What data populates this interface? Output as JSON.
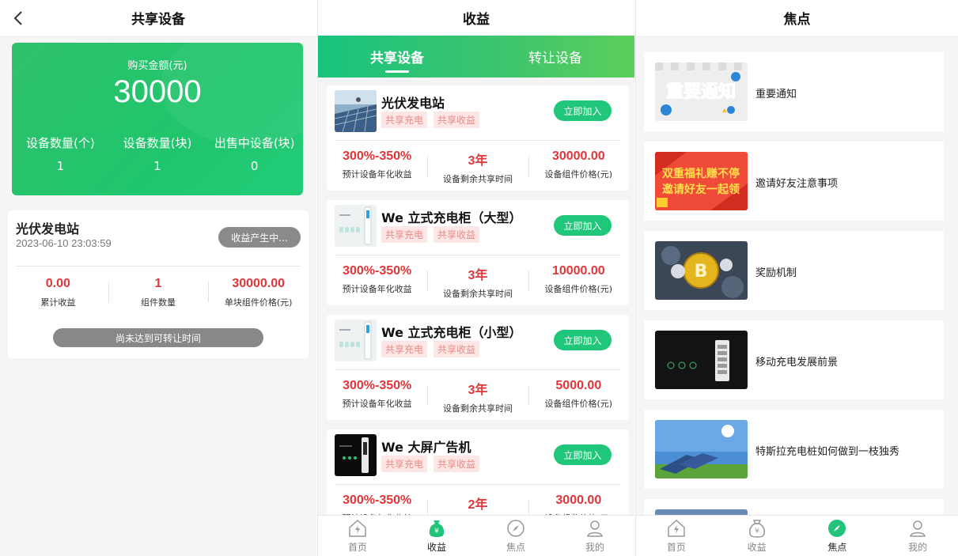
{
  "shared_devices_page": {
    "title": "共享设备",
    "summary": {
      "amount_label": "购买金额(元)",
      "amount": "30000",
      "stats": [
        {
          "label": "设备数量(个)",
          "value": "1"
        },
        {
          "label": "设备数量(块)",
          "value": "1"
        },
        {
          "label": "出售中设备(块)",
          "value": "0"
        }
      ]
    },
    "holding": {
      "name": "光伏发电站",
      "time": "2023-06-10 23:03:59",
      "status": "收益产生中...",
      "values": [
        {
          "value": "0.00",
          "label": "累计收益"
        },
        {
          "value": "1",
          "label": "组件数量"
        },
        {
          "value": "30000.00",
          "label": "单块组件价格(元)"
        }
      ],
      "transfer_button": "尚未达到可转让时间"
    }
  },
  "income_page": {
    "title": "收益",
    "tabs": [
      "共享设备",
      "转让设备"
    ],
    "active_tab": 0,
    "join_label": "立即加入",
    "tags": [
      "共享充电",
      "共享收益"
    ],
    "metric_labels": [
      "预计设备年化收益",
      "设备剩余共享时间",
      "设备组件价格(元)"
    ],
    "products": [
      {
        "name": "光伏发电站",
        "yield": "300%-350%",
        "duration": "3年",
        "price": "30000.00"
      },
      {
        "name": "We 立式充电柜（大型）",
        "yield": "300%-350%",
        "duration": "3年",
        "price": "10000.00"
      },
      {
        "name": "We 立式充电柜（小型）",
        "yield": "300%-350%",
        "duration": "3年",
        "price": "5000.00"
      },
      {
        "name": "We 大屏广告机",
        "yield": "300%-350%",
        "duration": "2年",
        "price": "3000.00"
      }
    ]
  },
  "focus_page": {
    "title": "焦点",
    "news": [
      {
        "title": "重要通知",
        "banner": "重要通知"
      },
      {
        "title": "邀请好友注意事项",
        "banner_line1": "双重福礼赚不停",
        "banner_line2": "邀请好友一起领"
      },
      {
        "title": "奖励机制"
      },
      {
        "title": "移动充电发展前景"
      },
      {
        "title": "特斯拉充电桩如何做到一枝独秀"
      }
    ]
  },
  "nav": {
    "items": [
      "首页",
      "收益",
      "焦点",
      "我的"
    ],
    "active_income": 1,
    "active_focus": 2
  },
  "colors": {
    "brand_green": "#20c77a",
    "value_red": "#e0363a",
    "tag_bg": "#fde7e6"
  }
}
